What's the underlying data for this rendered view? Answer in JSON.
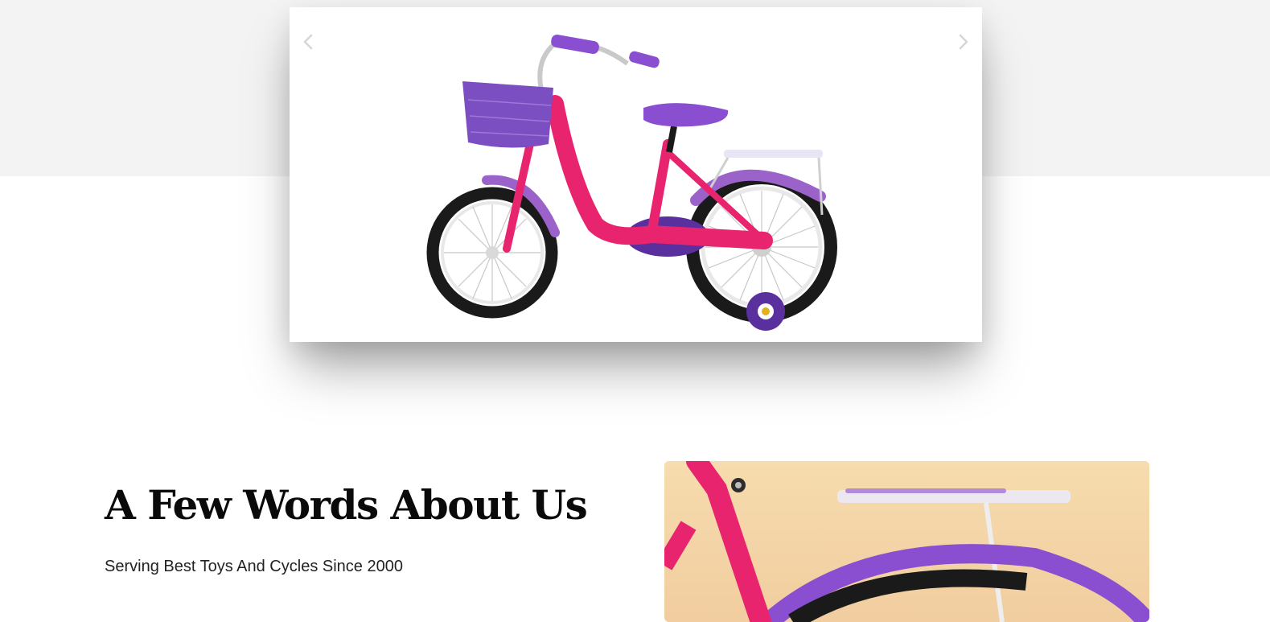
{
  "slider": {
    "prev_icon": "chevron-left-icon",
    "next_icon": "chevron-right-icon",
    "image_subject": "bicycle"
  },
  "about": {
    "title": "A Few Words About Us",
    "subtitle": "Serving Best Toys And Cycles Since 2000"
  },
  "colors": {
    "bike_pink": "#e8246f",
    "bike_purple": "#7b4fc2",
    "tire_black": "#1a1a1a",
    "band_gray": "#f3f3f3",
    "about_bg": "#f6d9a8"
  }
}
